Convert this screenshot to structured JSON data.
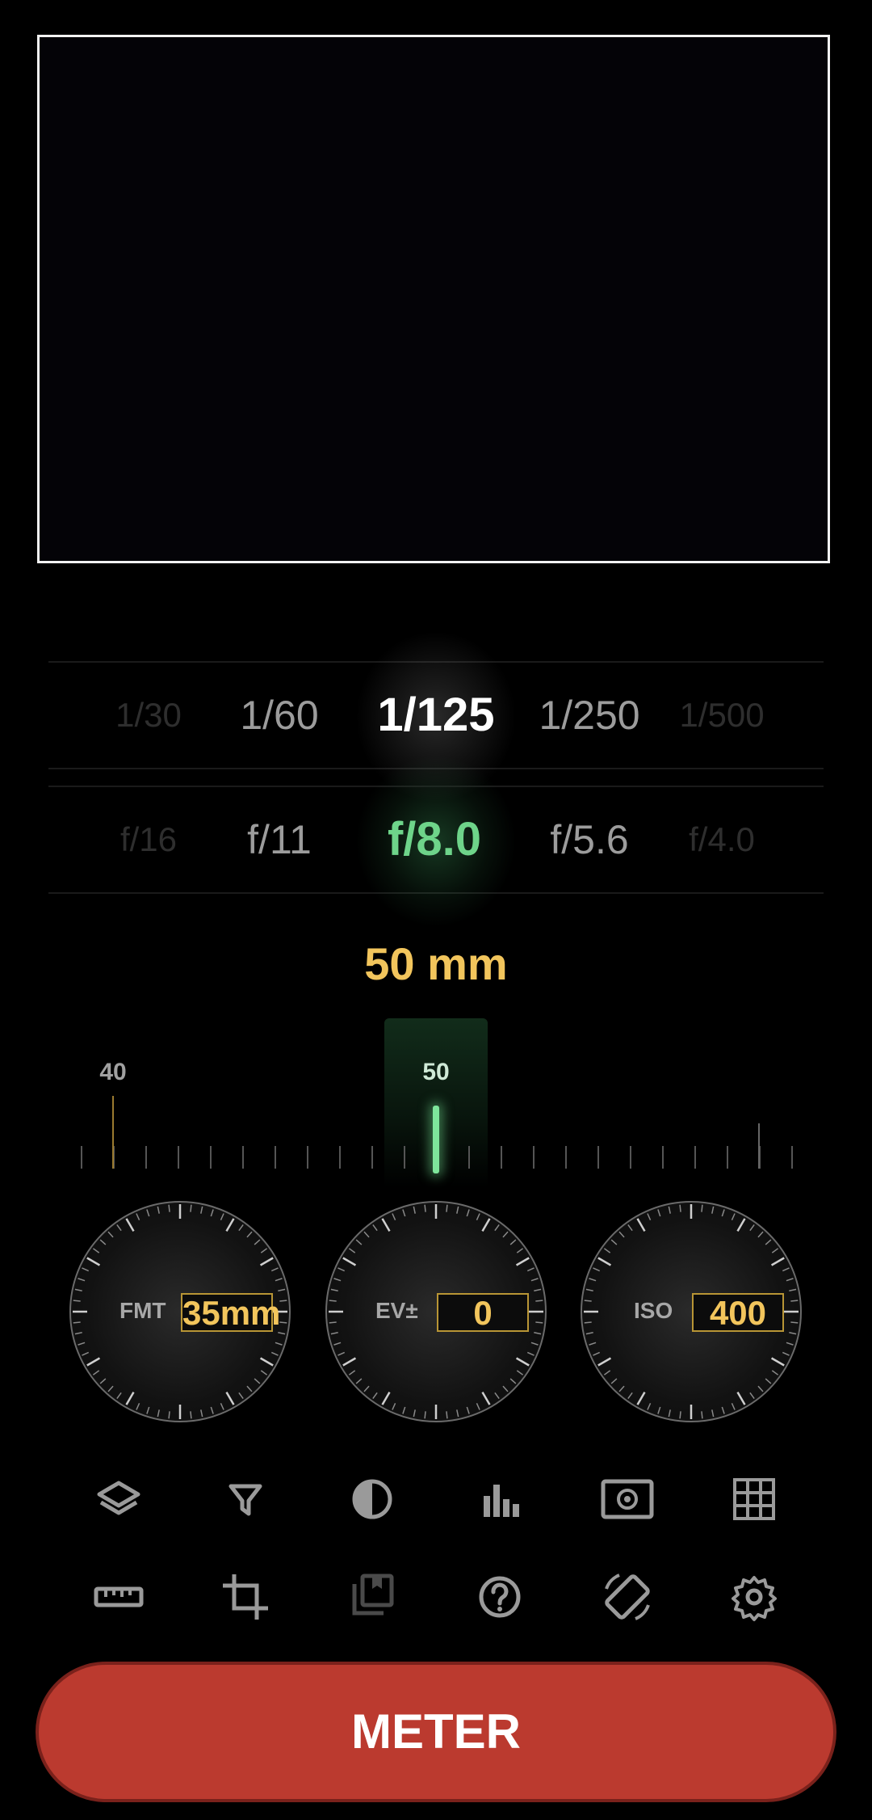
{
  "shutter_speeds": [
    "1/30",
    "1/60",
    "1/125",
    "1/250",
    "1/500"
  ],
  "apertures": [
    "f/16",
    "f/11",
    "f/8.0",
    "f/5.6",
    "f/4.0"
  ],
  "focal_length_label": "50 mm",
  "zoom_ruler": {
    "labels": [
      "40",
      "50"
    ]
  },
  "knobs": {
    "format": {
      "label": "FMT",
      "value": "35mm"
    },
    "ev": {
      "label": "EV±",
      "value": "0"
    },
    "iso": {
      "label": "ISO",
      "value": "400"
    }
  },
  "toolbar_icons": [
    "layers-icon",
    "filter-icon",
    "contrast-icon",
    "histogram-icon",
    "spot-meter-icon",
    "grid-icon",
    "ruler-icon",
    "crop-icon",
    "saved-frames-icon",
    "help-icon",
    "rotate-screen-icon",
    "settings-icon"
  ],
  "meter_button_label": "METER",
  "colors": {
    "accent_yellow": "#f2c55c",
    "accent_green": "#6ed48a",
    "meter_red": "#bb3a2f"
  }
}
